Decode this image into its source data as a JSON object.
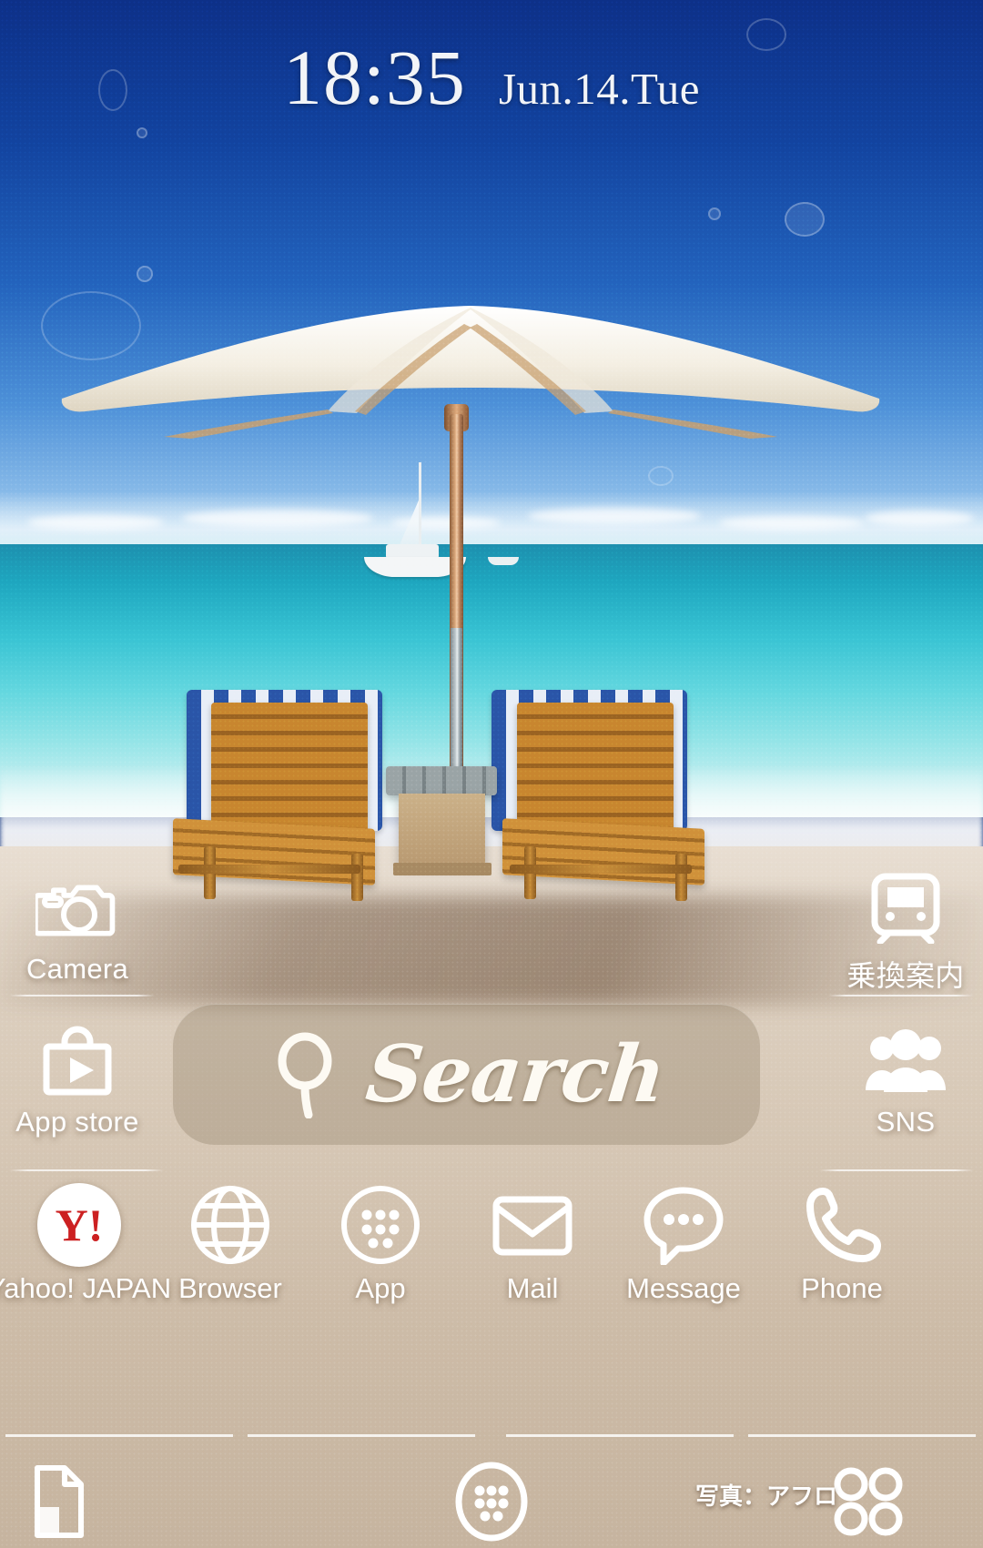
{
  "statusbar": {
    "time": "18:35",
    "date": "Jun.14.Tue"
  },
  "theme": {
    "name": "beach-umbrella-wallpaper",
    "accent_white": "#ffffff",
    "search_pill": "#968760",
    "yahoo_red": "#cc2021",
    "sky_blue": "#12439f",
    "sea_teal": "#38c3d3",
    "sand": "#d6c7b5"
  },
  "home": {
    "shortcuts": [
      {
        "label": "Camera",
        "icon": "camera-icon"
      },
      {
        "label": "乗換案内",
        "icon": "train-icon"
      },
      {
        "label": "App store",
        "icon": "shopping-bag-play-icon"
      },
      {
        "label": "SNS",
        "icon": "people-group-icon"
      }
    ],
    "search": {
      "label": "Search",
      "icon": "magnifier-icon"
    },
    "dock": [
      {
        "label": "Yahoo! JAPAN",
        "icon": "yahoo-japan-icon",
        "mark": "Y!"
      },
      {
        "label": "Browser",
        "icon": "globe-icon"
      },
      {
        "label": "App",
        "icon": "app-grid-icon"
      },
      {
        "label": "Mail",
        "icon": "envelope-icon"
      },
      {
        "label": "Message",
        "icon": "chat-bubble-icon"
      },
      {
        "label": "Phone",
        "icon": "phone-handset-icon"
      }
    ]
  },
  "bottombar": {
    "buttons": [
      {
        "name": "pages-icon"
      },
      {
        "name": "app-drawer-icon"
      },
      {
        "name": "widgets-grid-icon"
      }
    ],
    "photo_credit": "写真：アフロ"
  }
}
